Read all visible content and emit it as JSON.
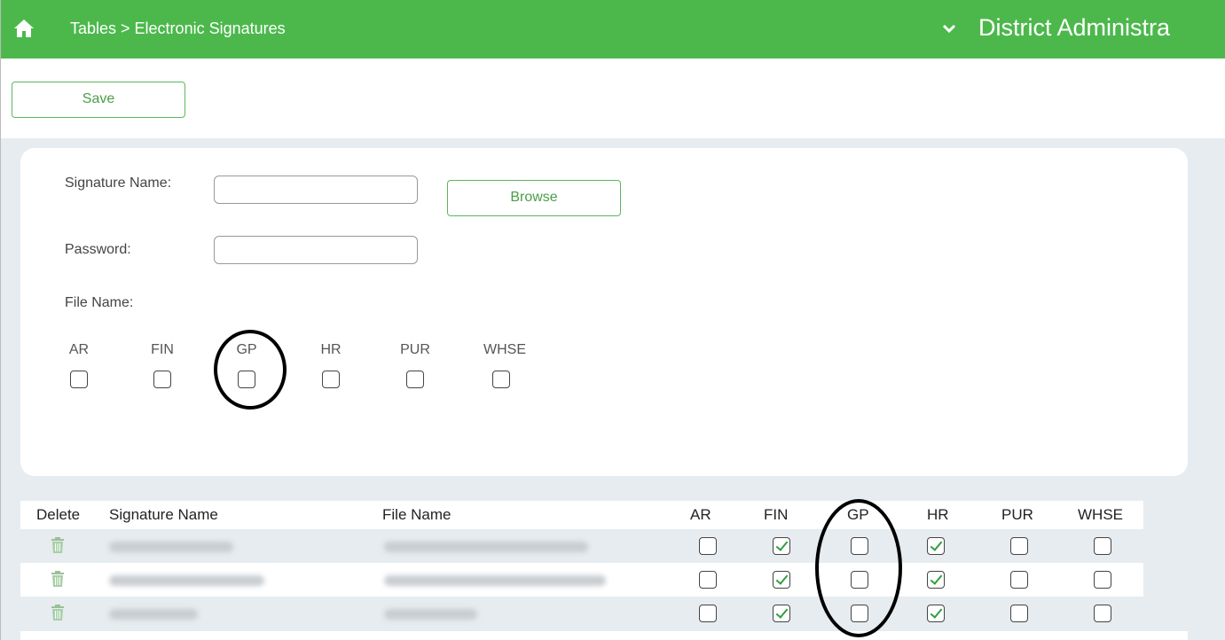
{
  "header": {
    "breadcrumb": "Tables > Electronic Signatures",
    "district": "District Administra"
  },
  "toolbar": {
    "save_label": "Save"
  },
  "form": {
    "signature_name_label": "Signature Name:",
    "signature_name_value": "",
    "browse_label": "Browse",
    "password_label": "Password:",
    "password_value": "",
    "file_name_label": "File Name:",
    "modules": [
      {
        "label": "AR",
        "checked": false
      },
      {
        "label": "FIN",
        "checked": false
      },
      {
        "label": "GP",
        "checked": false
      },
      {
        "label": "HR",
        "checked": false
      },
      {
        "label": "PUR",
        "checked": false
      },
      {
        "label": "WHSE",
        "checked": false
      }
    ]
  },
  "table": {
    "columns": [
      "Delete",
      "Signature Name",
      "File Name",
      "AR",
      "FIN",
      "GP",
      "HR",
      "PUR",
      "WHSE"
    ],
    "rows": [
      {
        "AR": false,
        "FIN": true,
        "GP": false,
        "HR": true,
        "PUR": false,
        "WHSE": false
      },
      {
        "AR": false,
        "FIN": true,
        "GP": false,
        "HR": true,
        "PUR": false,
        "WHSE": false
      },
      {
        "AR": false,
        "FIN": true,
        "GP": false,
        "HR": true,
        "PUR": false,
        "WHSE": false
      }
    ]
  },
  "colors": {
    "header_green": "#4cb84c",
    "accent_green": "#5cb85c",
    "panel_grey": "#e6ecef"
  }
}
